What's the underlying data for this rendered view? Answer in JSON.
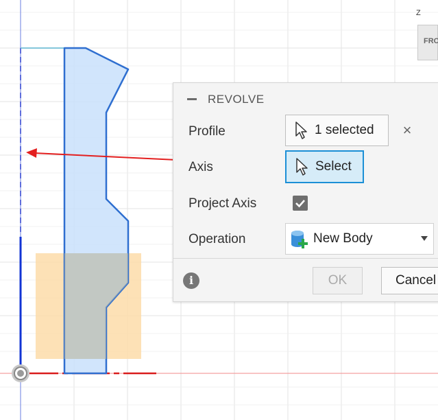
{
  "panel": {
    "title": "REVOLVE",
    "profile": {
      "label": "Profile",
      "button": "1 selected"
    },
    "axis": {
      "label": "Axis",
      "button": "Select"
    },
    "project_axis": {
      "label": "Project Axis",
      "checked": true
    },
    "operation": {
      "label": "Operation",
      "value": "New Body"
    },
    "ok_label": "OK",
    "cancel_label": "Cancel"
  },
  "viewcube": {
    "face": "FRO",
    "axis": "Z"
  },
  "colors": {
    "profile_fill": "#c9e1fb",
    "profile_stroke": "#2f6fd0",
    "orange_fill": "#fddca9",
    "arrow": "#e31f1f",
    "axis_line": "#1234d4"
  },
  "icons": [
    "cursor-icon",
    "close-icon",
    "checkmark-icon",
    "new-body-icon",
    "info-icon",
    "origin-icon"
  ]
}
